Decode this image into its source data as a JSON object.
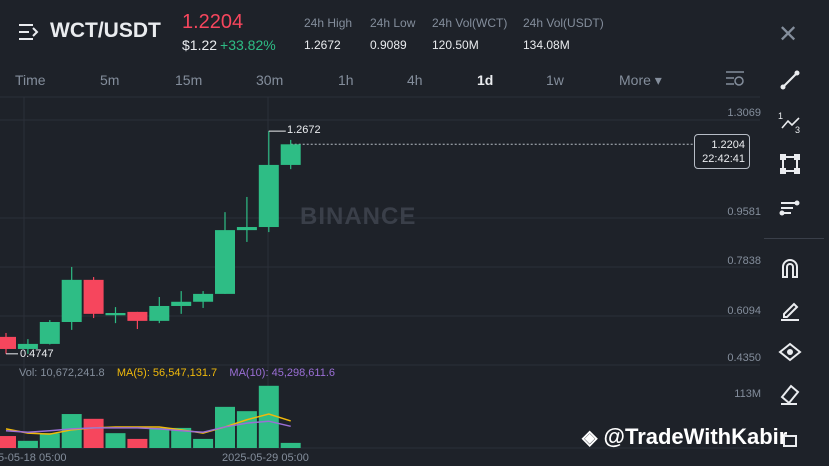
{
  "header": {
    "pair": "WCT/USDT",
    "last_price": "1.2204",
    "usd_price": "$1.22",
    "change": "+33.82%",
    "stats": [
      {
        "label": "24h High",
        "value": "1.2672"
      },
      {
        "label": "24h Low",
        "value": "0.9089"
      },
      {
        "label": "24h Vol(WCT)",
        "value": "120.50M"
      },
      {
        "label": "24h Vol(USDT)",
        "value": "134.08M"
      }
    ]
  },
  "timeframes": [
    "Time",
    "5m",
    "15m",
    "30m",
    "1h",
    "4h",
    "1d",
    "1w",
    "More ▾"
  ],
  "active_timeframe": "1d",
  "price_axis": [
    "1.3069",
    "0.9581",
    "0.7838",
    "0.6094",
    "0.4350"
  ],
  "last_box": {
    "price": "1.2204",
    "countdown": "22:42:41"
  },
  "high_label": "1.2672",
  "low_label": "0.4747",
  "volume_legend": {
    "vol": "Vol: 10,672,241.8",
    "ma5": "MA(5): 56,547,131.7",
    "ma10": "MA(10): 45,298,611.6"
  },
  "volume_axis": "113M",
  "x_labels": [
    "5-05-18 05:00",
    "2025-05-29 05:00"
  ],
  "watermark": "BINANCE",
  "credit": "@TradeWithKabir",
  "colors": {
    "up": "#2ebd85",
    "down": "#f6465d",
    "ma5": "#f0b90b",
    "ma10": "#9b6fd6"
  },
  "chart_data": {
    "type": "candlestick",
    "price_range": [
      0.435,
      1.3069
    ],
    "candles": [
      {
        "o": 0.535,
        "h": 0.549,
        "l": 0.4747,
        "c": 0.492
      },
      {
        "o": 0.492,
        "h": 0.527,
        "l": 0.4747,
        "c": 0.51
      },
      {
        "o": 0.51,
        "h": 0.595,
        "l": 0.508,
        "c": 0.588
      },
      {
        "o": 0.588,
        "h": 0.784,
        "l": 0.56,
        "c": 0.738
      },
      {
        "o": 0.738,
        "h": 0.748,
        "l": 0.602,
        "c": 0.617
      },
      {
        "o": 0.612,
        "h": 0.641,
        "l": 0.584,
        "c": 0.62
      },
      {
        "o": 0.624,
        "h": 0.624,
        "l": 0.563,
        "c": 0.592
      },
      {
        "o": 0.592,
        "h": 0.677,
        "l": 0.584,
        "c": 0.645
      },
      {
        "o": 0.645,
        "h": 0.698,
        "l": 0.617,
        "c": 0.66
      },
      {
        "o": 0.66,
        "h": 0.698,
        "l": 0.638,
        "c": 0.688
      },
      {
        "o": 0.688,
        "h": 0.979,
        "l": 0.688,
        "c": 0.915
      },
      {
        "o": 0.915,
        "h": 1.033,
        "l": 0.873,
        "c": 0.926
      },
      {
        "o": 0.926,
        "h": 1.2672,
        "l": 0.908,
        "c": 1.147
      },
      {
        "o": 1.147,
        "h": 1.236,
        "l": 1.132,
        "c": 1.2204
      }
    ],
    "volume_millions": [
      25,
      15,
      31,
      71,
      61,
      31,
      19,
      42,
      42,
      19,
      86,
      77,
      130,
      10.67
    ],
    "ma5_millions": [
      40,
      31,
      29,
      38,
      42,
      44,
      44,
      44,
      38,
      31,
      44,
      59,
      71,
      56.5
    ],
    "ma10_millions": [
      36,
      33,
      36,
      40,
      42,
      42,
      42,
      40,
      36,
      33,
      44,
      52,
      56,
      45.3
    ]
  }
}
